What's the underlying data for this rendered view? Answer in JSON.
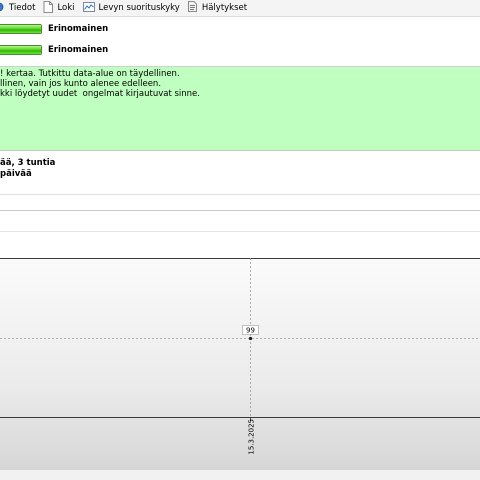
{
  "toolbar": {
    "items": [
      {
        "label": "Tiedot",
        "icon": "info-icon"
      },
      {
        "label": "Loki",
        "icon": "log-document-icon"
      },
      {
        "label": "Levyn suorituskyky",
        "icon": "performance-chart-icon"
      },
      {
        "label": "Hälytykset",
        "icon": "alerts-icon"
      }
    ]
  },
  "status": {
    "rows": [
      {
        "label": "Erinomainen",
        "level": 1.0
      },
      {
        "label": "Erinomainen",
        "level": 1.0
      }
    ],
    "bar_color": "#3fc20c"
  },
  "message": {
    "background": "#bfffbf",
    "lines": [
      "! kertaa. Tutkittu data-alue on täydellinen.",
      "llinen, vain jos kunto alenee edelleen.",
      "kki löydetyt uudet  ongelmat kirjautuvat sinne."
    ]
  },
  "info": {
    "line1": "ää, 3 tuntia",
    "line2": "päivää"
  },
  "chart_data": {
    "type": "line",
    "x": [
      "15.3.2025"
    ],
    "series": [
      {
        "values": [
          99
        ]
      }
    ],
    "point_label": "99",
    "x_tick_labels": [
      "15.3.2025"
    ],
    "grid": true
  }
}
